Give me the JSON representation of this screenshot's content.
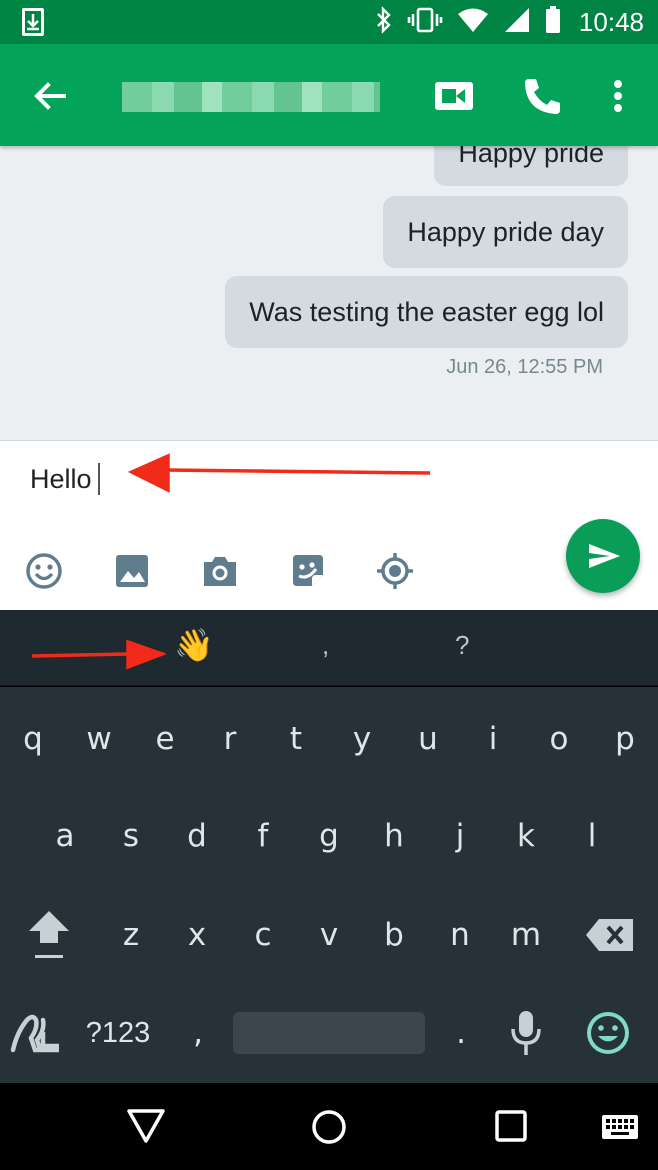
{
  "status_bar": {
    "time": "10:48"
  },
  "app_bar": {
    "contact_name": ""
  },
  "messages": [
    {
      "text": "Happy pride"
    },
    {
      "text": "Happy pride day"
    },
    {
      "text": "Was testing the easter egg lol"
    }
  ],
  "timestamp": "Jun 26, 12:55 PM",
  "compose": {
    "value": "Hello"
  },
  "suggestions": {
    "emoji": "👋",
    "middle": ",",
    "right": "?"
  },
  "keyboard": {
    "row1": [
      "q",
      "w",
      "e",
      "r",
      "t",
      "y",
      "u",
      "i",
      "o",
      "p"
    ],
    "row2": [
      "a",
      "s",
      "d",
      "f",
      "g",
      "h",
      "j",
      "k",
      "l"
    ],
    "row3": [
      "z",
      "x",
      "c",
      "v",
      "b",
      "n",
      "m"
    ],
    "symbols_label": "?123",
    "comma": ",",
    "period": "."
  },
  "colors": {
    "status_bar": "#008443",
    "app_bar": "#03a35a",
    "bubble": "#d3dbe0",
    "send_button": "#0a9d58",
    "keyboard": "#263238",
    "annotation_arrow": "#f22a1a"
  }
}
